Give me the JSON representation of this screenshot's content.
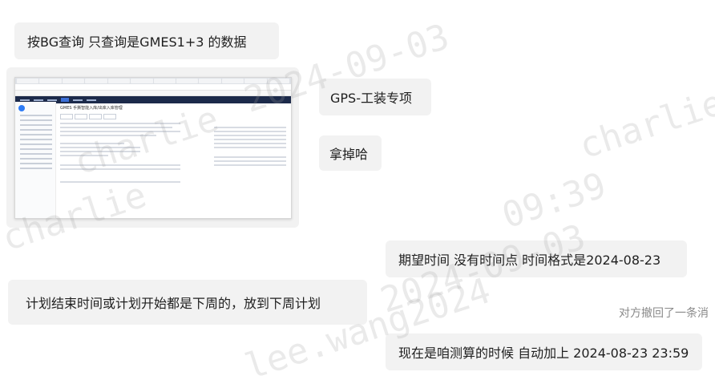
{
  "messages": [
    {
      "id": "m1",
      "text": "按BG查询 只查询是GMES1+3 的数据"
    },
    {
      "id": "m2",
      "text": "GPS-工装专项"
    },
    {
      "id": "m3",
      "text": "拿掉哈"
    },
    {
      "id": "m4",
      "text": "期望时间 没有时间点  时间格式是2024-08-23"
    },
    {
      "id": "m5",
      "text": "计划结束时间或计划开始都是下周的，放到下周计划"
    },
    {
      "id": "m6",
      "text": "现在是咱测算的时候 自动加上 2024-08-23 23:59"
    }
  ],
  "recall_notice": "对方撤回了一条消",
  "screenshot_title": "GMES 手撕智能入库/出库入库管理",
  "watermarks": [
    "charlie",
    "charlie",
    "09:39",
    "lee.wang2024",
    "2024-09-03",
    "2024-09-03",
    "charlie"
  ],
  "colors": {
    "bubble_bg": "#f2f2f2",
    "recall_text": "#8a8a8a"
  }
}
